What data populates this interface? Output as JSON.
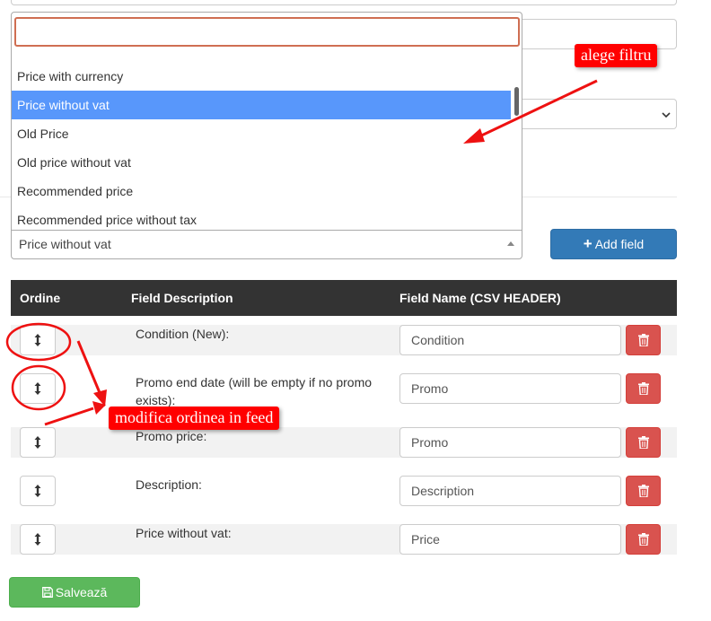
{
  "dropdown": {
    "options": [
      {
        "label": "Price with currency",
        "selected": false
      },
      {
        "label": "Price without vat",
        "selected": true
      },
      {
        "label": "Old Price",
        "selected": false
      },
      {
        "label": "Old price without vat",
        "selected": false
      },
      {
        "label": "Recommended price",
        "selected": false
      },
      {
        "label": "Recommended price without tax",
        "selected": false
      }
    ],
    "selected_value": "Price without vat"
  },
  "toolbar": {
    "add_field_label": "Add field"
  },
  "table": {
    "headers": {
      "order": "Ordine",
      "description": "Field Description",
      "field_name": "Field Name (CSV HEADER)"
    },
    "rows": [
      {
        "description": "Condition (New):",
        "field_name": "Condition"
      },
      {
        "description": "Promo end date (will be empty if no promo exists):",
        "field_name": "Promo"
      },
      {
        "description": "Promo price:",
        "field_name": "Promo"
      },
      {
        "description": "Description:",
        "field_name": "Description"
      },
      {
        "description": "Price without vat:",
        "field_name": "Price"
      }
    ]
  },
  "save_label": "Salvează",
  "annotations": {
    "filter_note": "alege filtru",
    "order_note": "modifica ordinea in feed"
  },
  "colors": {
    "primary": "#337ab7",
    "danger": "#d9534f",
    "success": "#5cb85c",
    "highlight": "#5897fb",
    "annotation": "#ff0000"
  },
  "icons": [
    "sort-icon",
    "trash-icon",
    "plus-icon",
    "floppy-disk-icon",
    "caret-up-icon",
    "chevron-down-icon"
  ]
}
